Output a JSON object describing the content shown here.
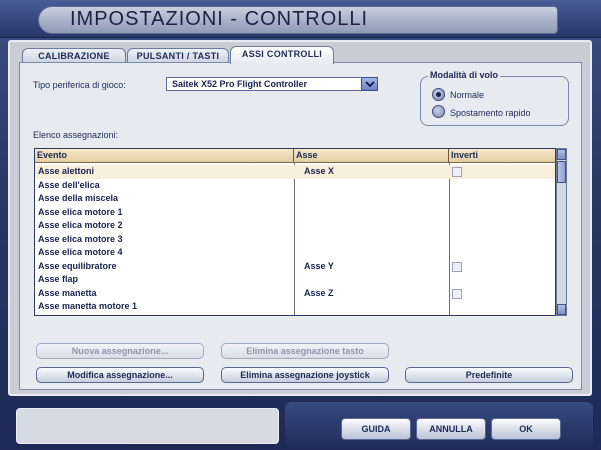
{
  "window": {
    "title": "IMPOSTAZIONI - CONTROLLI"
  },
  "tabs": [
    {
      "label": "CALIBRAZIONE",
      "active": false
    },
    {
      "label": "PULSANTI / TASTI",
      "active": false
    },
    {
      "label": "ASSI CONTROLLI",
      "active": true
    }
  ],
  "device": {
    "label": "Tipo periferica di gioco:",
    "selected": "Saitek X52 Pro Flight Controller"
  },
  "flight_mode": {
    "title": "Modalità di volo",
    "options": [
      {
        "label": "Normale",
        "selected": true
      },
      {
        "label": "Spostamento rapido",
        "selected": false
      }
    ]
  },
  "assignments": {
    "label": "Elenco assegnazioni:",
    "columns": [
      "Evento",
      "Asse",
      "Inverti"
    ],
    "rows": [
      {
        "event": "Asse alettoni",
        "axis": "Asse X",
        "invert": false,
        "has_checkbox": true
      },
      {
        "event": "Asse dell'elica",
        "axis": "",
        "invert": false,
        "has_checkbox": false
      },
      {
        "event": "Asse della miscela",
        "axis": "",
        "invert": false,
        "has_checkbox": false
      },
      {
        "event": "Asse elica motore 1",
        "axis": "",
        "invert": false,
        "has_checkbox": false
      },
      {
        "event": "Asse elica motore 2",
        "axis": "",
        "invert": false,
        "has_checkbox": false
      },
      {
        "event": "Asse elica motore 3",
        "axis": "",
        "invert": false,
        "has_checkbox": false
      },
      {
        "event": "Asse elica motore 4",
        "axis": "",
        "invert": false,
        "has_checkbox": false
      },
      {
        "event": "Asse equilibratore",
        "axis": "Asse Y",
        "invert": false,
        "has_checkbox": true
      },
      {
        "event": "Asse flap",
        "axis": "",
        "invert": false,
        "has_checkbox": false
      },
      {
        "event": "Asse manetta",
        "axis": "Asse Z",
        "invert": false,
        "has_checkbox": true
      },
      {
        "event": "Asse manetta motore 1",
        "axis": "",
        "invert": false,
        "has_checkbox": false
      }
    ]
  },
  "actions": {
    "new": "Nuova assegnazione...",
    "delete_key": "Elimina assegnazione tasto",
    "modify": "Modifica assegnazione...",
    "delete_joystick": "Elimina assegnazione joystick",
    "defaults": "Predefinite"
  },
  "footer": {
    "help": "GUIDA",
    "cancel": "ANNULLA",
    "ok": "OK"
  },
  "colors": {
    "frame": "#2a3866",
    "panel": "#e7eaef",
    "header_bg": "#e2cfa2",
    "text": "#1f2a55"
  }
}
